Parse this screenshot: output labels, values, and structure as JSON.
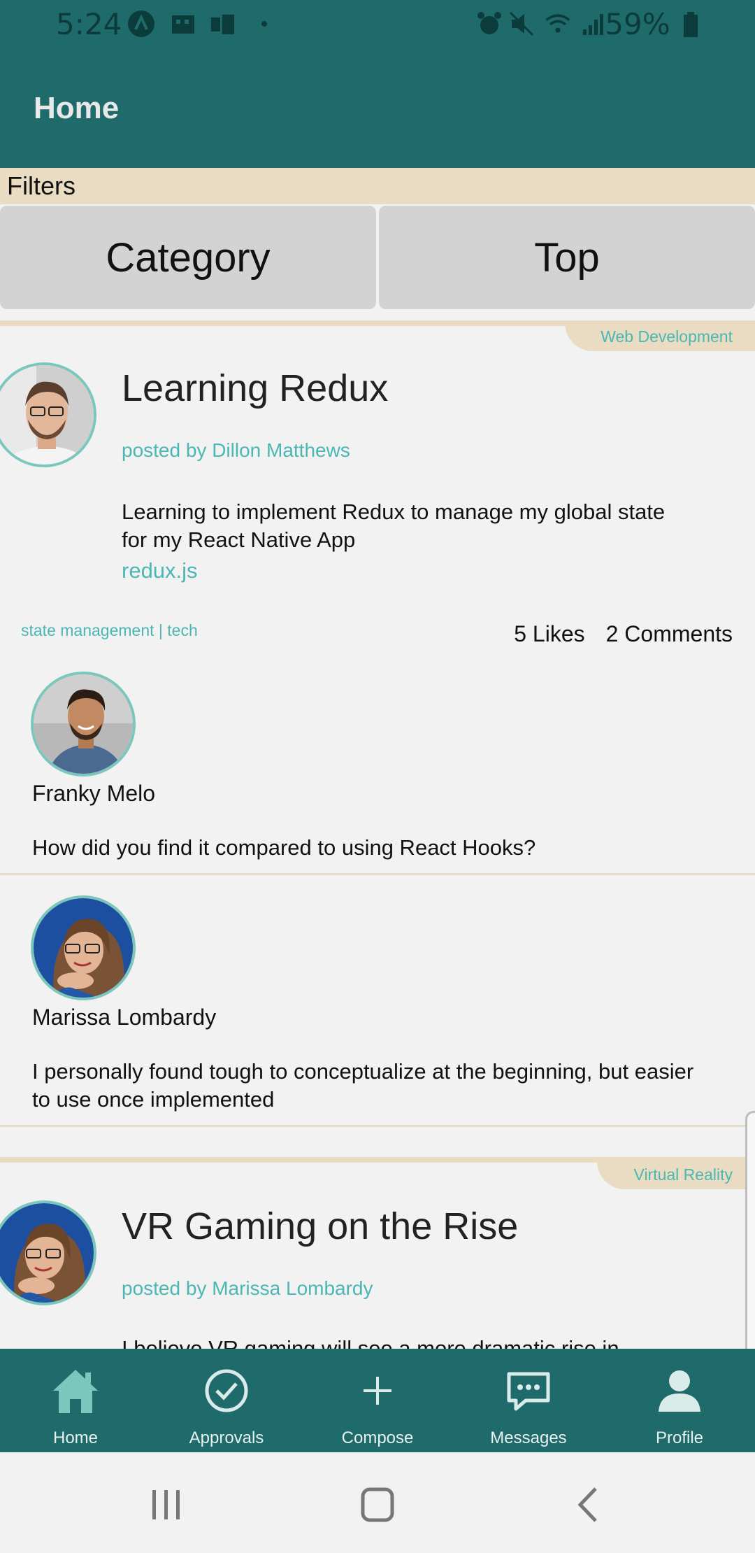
{
  "status_bar": {
    "time": "5:24",
    "battery": "59%"
  },
  "app_bar": {
    "title": "Home"
  },
  "filters": {
    "label": "Filters",
    "buttons": [
      "Category",
      "Top"
    ]
  },
  "posts": [
    {
      "category": "Web Development",
      "title": "Learning Redux",
      "posted_by": "posted by Dillon Matthews",
      "body": "Learning to implement Redux to manage my global state for my React Native App",
      "link": "redux.js",
      "tags": "state management | tech",
      "likes": "5 Likes",
      "comments_count": "2 Comments",
      "comments": [
        {
          "name": "Franky Melo",
          "text": "How did you find it compared to using React Hooks?"
        },
        {
          "name": "Marissa Lombardy",
          "text": "I personally found tough to conceptualize at the beginning, but easier to use once implemented"
        }
      ]
    },
    {
      "category": "Virtual Reality",
      "title": "VR Gaming on the Rise",
      "posted_by": "posted by Marissa Lombardy",
      "body": "I believe VR gaming will see a more dramatic rise in"
    }
  ],
  "bottom_nav": {
    "items": [
      {
        "label": "Home",
        "icon": "home-icon"
      },
      {
        "label": "Approvals",
        "icon": "check-circle-icon"
      },
      {
        "label": "Compose",
        "icon": "plus-icon"
      },
      {
        "label": "Messages",
        "icon": "chat-icon"
      },
      {
        "label": "Profile",
        "icon": "person-icon"
      }
    ]
  },
  "colors": {
    "primary": "#1f6b6b",
    "accent": "#4bb7b4",
    "tan": "#e9dcc2",
    "avatar_border": "#7cc7bd"
  }
}
